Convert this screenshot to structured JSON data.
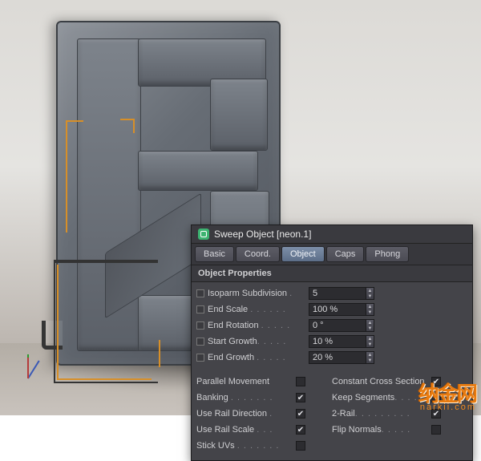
{
  "panel": {
    "title": "Sweep Object [neon.1]",
    "tabs": [
      "Basic",
      "Coord.",
      "Object",
      "Caps",
      "Phong"
    ],
    "active_tab": 2,
    "section": "Object Properties",
    "params": [
      {
        "label": "Isoparm Subdivision",
        "value": "5"
      },
      {
        "label": "End Scale",
        "value": "100 %"
      },
      {
        "label": "End Rotation",
        "value": "0 °"
      },
      {
        "label": "Start Growth",
        "value": "10 %"
      },
      {
        "label": "End Growth",
        "value": "20 %"
      }
    ],
    "checks_left": [
      {
        "label": "Parallel Movement",
        "checked": false
      },
      {
        "label": "Banking",
        "checked": true
      },
      {
        "label": "Use Rail Direction",
        "checked": true
      },
      {
        "label": "Use Rail Scale",
        "checked": true
      },
      {
        "label": "Stick UVs",
        "checked": false
      }
    ],
    "checks_right": [
      {
        "label": "Constant Cross Section",
        "checked": true
      },
      {
        "label": "Keep Segments",
        "checked": false
      },
      {
        "label": "2-Rail",
        "checked": true
      },
      {
        "label": "Flip Normals",
        "checked": false
      }
    ]
  },
  "watermark": {
    "brand": "纳金网",
    "url": "narkii.com"
  }
}
